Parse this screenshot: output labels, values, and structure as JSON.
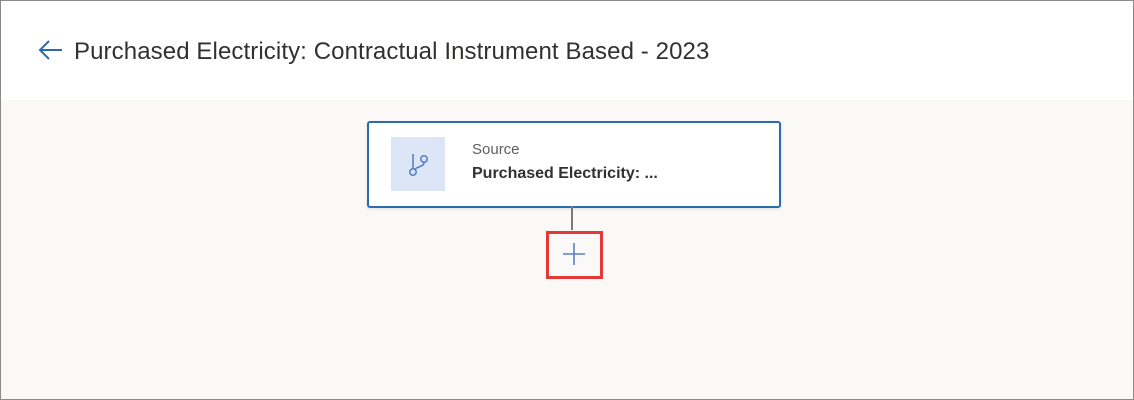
{
  "header": {
    "title": "Purchased Electricity: Contractual Instrument Based - 2023",
    "back_icon": "arrow-left-icon"
  },
  "flow": {
    "source_node": {
      "type_label": "Source",
      "name": "Purchased Electricity: ...",
      "icon": "branch-icon"
    },
    "add_step_icon": "plus-icon"
  },
  "colors": {
    "accent": "#2b6cb0",
    "icon_bg": "#dce6f7",
    "highlight": "#e53935",
    "canvas_bg": "#faf9f8"
  }
}
